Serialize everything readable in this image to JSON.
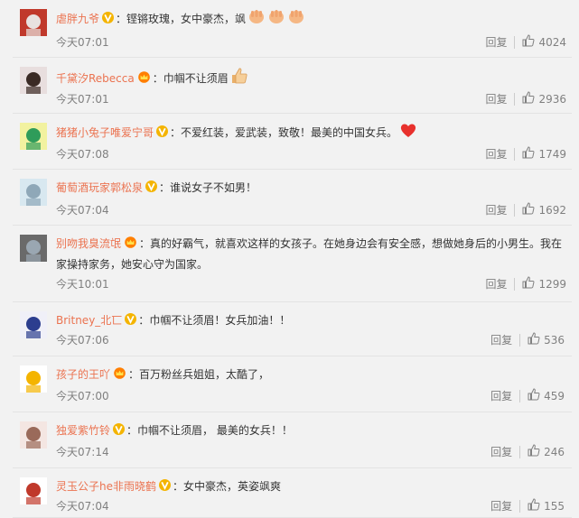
{
  "comments": [
    {
      "user": "虐胖九爷",
      "badge": "v-gold",
      "text": "铿锵玫瑰，女中豪杰，飒",
      "emoji": [
        "clap-icon",
        "clap-icon",
        "clap-icon"
      ],
      "time": "今天07:01",
      "reply": "回复",
      "likes": "4024"
    },
    {
      "user": "千黛汐Rebecca",
      "badge": "crown",
      "text": "巾帼不让须眉",
      "emoji": [
        "thumbs-up-icon"
      ],
      "time": "今天07:01",
      "reply": "回复",
      "likes": "2936"
    },
    {
      "user": "猪猪小兔子唯爱宁哥",
      "badge": "v-gold",
      "text": "不爱红装，爱武装，致敬！最美的中国女兵。",
      "emoji": [
        "heart-icon"
      ],
      "time": "今天07:08",
      "reply": "回复",
      "likes": "1749"
    },
    {
      "user": "葡萄酒玩家郭松泉",
      "badge": "v-gold",
      "text": "谁说女子不如男！",
      "emoji": [],
      "time": "今天07:04",
      "reply": "回复",
      "likes": "1692"
    },
    {
      "user": "别吻我臭流氓",
      "badge": "crown",
      "text": "真的好霸气，就喜欢这样的女孩子。在她身边会有安全感，想做她身后的小男生。我在家操持家务，她安心守为国家。",
      "emoji": [],
      "time": "今天10:01",
      "reply": "回复",
      "likes": "1299"
    },
    {
      "user": "Britney_北匸",
      "badge": "v-gold",
      "text": "巾帼不让须眉！女兵加油！！",
      "emoji": [],
      "time": "今天07:06",
      "reply": "回复",
      "likes": "536"
    },
    {
      "user": "孩子的王吖",
      "badge": "crown",
      "text": "百万粉丝兵姐姐，太酷了，",
      "emoji": [],
      "time": "今天07:00",
      "reply": "回复",
      "likes": "459"
    },
    {
      "user": "独爱紫竹铃",
      "badge": "v-gold",
      "text": "巾帼不让须眉， 最美的女兵！！",
      "emoji": [],
      "time": "今天07:14",
      "reply": "回复",
      "likes": "246"
    },
    {
      "user": "灵玉公子he非雨晓鹤",
      "badge": "v-gold",
      "text": "女中豪杰，英姿飒爽",
      "emoji": [],
      "time": "今天07:04",
      "reply": "回复",
      "likes": "155"
    }
  ],
  "colors": {
    "username": "#eb7350",
    "time": "#808080",
    "gold": "#f4b400"
  },
  "colon": "："
}
